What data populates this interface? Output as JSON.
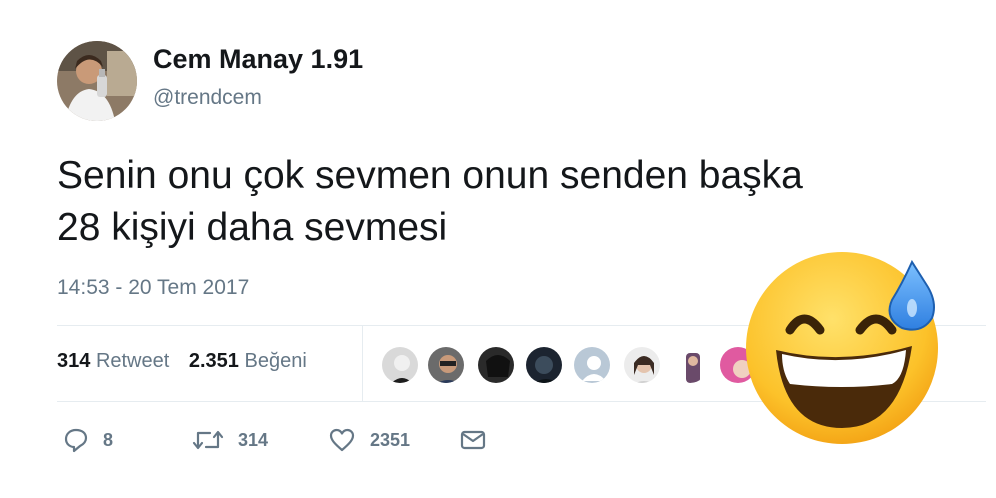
{
  "user": {
    "display_name": "Cem Manay 1.91",
    "handle": "@trendcem"
  },
  "tweet": {
    "text_line1": "Senin onu çok sevmen onun senden başka",
    "text_line2": "28 kişiyi daha sevmesi",
    "timestamp": "14:53 - 20 Tem 2017"
  },
  "stats": {
    "retweets": "314",
    "retweet_label": "Retweet",
    "likes": "2.351",
    "like_label": "Beğeni"
  },
  "actions": {
    "reply_count": "8",
    "retweet_count": "314",
    "like_count": "2351"
  },
  "icons": [
    "reply-icon",
    "retweet-icon",
    "heart-icon",
    "message-icon",
    "sweat-smile-emoji"
  ],
  "colors": {
    "text": "#14171a",
    "secondary": "#657786",
    "divider": "#e6ecf0",
    "emoji_yellow": "#fbc02d",
    "sweat_blue": "#4a9ef0"
  }
}
